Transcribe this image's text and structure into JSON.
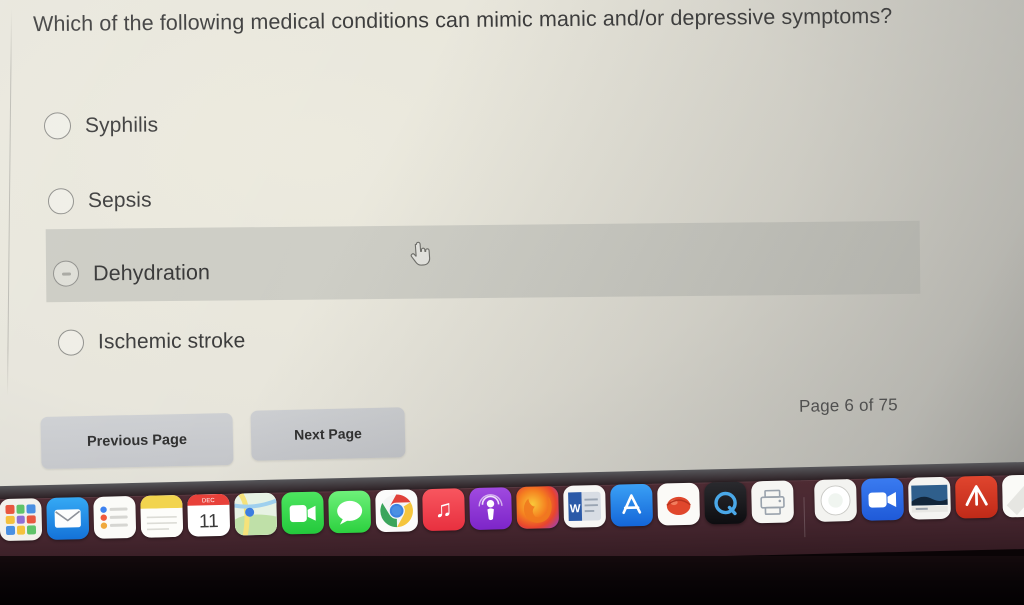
{
  "quiz": {
    "question": "Which of the following medical conditions can mimic manic and/or depressive symptoms?",
    "options": [
      {
        "label": "Syphilis",
        "selected": false,
        "highlighted": false
      },
      {
        "label": "Sepsis",
        "selected": false,
        "highlighted": false
      },
      {
        "label": "Dehydration",
        "selected": false,
        "highlighted": true
      },
      {
        "label": "Ischemic stroke",
        "selected": false,
        "highlighted": false
      }
    ],
    "page_indicator": "Page 6 of 75",
    "current_page": 6,
    "total_pages": 75,
    "buttons": {
      "previous": "Previous Page",
      "next": "Next Page"
    },
    "cursor": "pointing-hand-cursor",
    "colors": {
      "page_background": "#e8e7e0",
      "highlight_band": "#cfcfc7",
      "button_background": "#c7c9cd",
      "text": "#3a3a3a"
    }
  },
  "dock": {
    "background_color": "#472730",
    "items": [
      {
        "name": "launchpad",
        "label": "Launchpad",
        "running": false
      },
      {
        "name": "mail",
        "label": "Mail",
        "running": false
      },
      {
        "name": "reminders",
        "label": "Reminders",
        "running": false
      },
      {
        "name": "notes",
        "label": "Notes",
        "running": false
      },
      {
        "name": "calendar",
        "label": "Calendar",
        "badge": "11",
        "running": true
      },
      {
        "name": "maps",
        "label": "Maps",
        "running": true
      },
      {
        "name": "facetime",
        "label": "FaceTime",
        "running": false
      },
      {
        "name": "messages",
        "label": "Messages",
        "running": true
      },
      {
        "name": "chrome",
        "label": "Google Chrome",
        "running": true
      },
      {
        "name": "music",
        "label": "Music",
        "running": true
      },
      {
        "name": "podcasts",
        "label": "Podcasts",
        "running": true
      },
      {
        "name": "firefox",
        "label": "Firefox",
        "running": true
      },
      {
        "name": "word",
        "label": "Microsoft Word",
        "running": true
      },
      {
        "name": "app-store",
        "label": "App Store",
        "running": true
      },
      {
        "name": "photo-booth",
        "label": "Photo Booth",
        "running": false
      },
      {
        "name": "quicktime",
        "label": "QuickTime Player",
        "running": false
      },
      {
        "name": "printer",
        "label": "Printer",
        "running": false
      },
      {
        "name": "divider",
        "label": "",
        "running": false
      },
      {
        "name": "rcsb",
        "label": "Viewer",
        "running": true
      },
      {
        "name": "zoom",
        "label": "Zoom",
        "running": true
      },
      {
        "name": "screenshot",
        "label": "Screenshot",
        "running": true
      },
      {
        "name": "acrobat",
        "label": "Adobe Acrobat",
        "running": true
      },
      {
        "name": "stickies",
        "label": "Stickies",
        "running": true
      }
    ]
  }
}
